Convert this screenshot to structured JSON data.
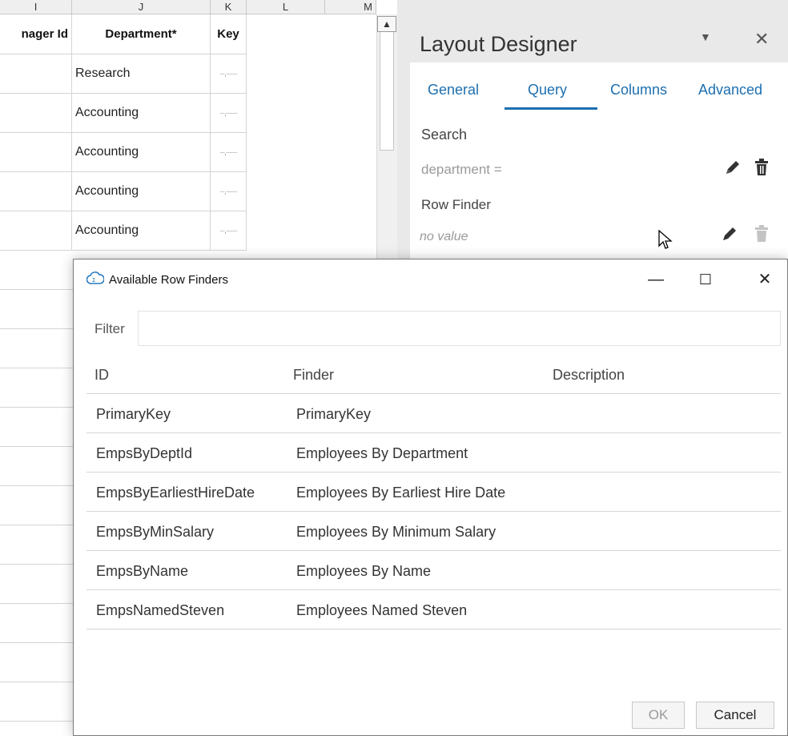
{
  "sheet": {
    "columns": [
      "I",
      "J",
      "K",
      "L",
      "M"
    ],
    "headers": {
      "manager_id": "nager Id",
      "department": "Department*",
      "key": "Key"
    },
    "rows": [
      {
        "dept": "Research",
        "key": "···,·······"
      },
      {
        "dept": "Accounting",
        "key": "···,·······"
      },
      {
        "dept": "Accounting",
        "key": "···,·······"
      },
      {
        "dept": "Accounting",
        "key": "···,·······"
      },
      {
        "dept": "Accounting",
        "key": "···,·······"
      }
    ]
  },
  "layout_designer": {
    "title": "Layout Designer",
    "tabs": [
      "General",
      "Query",
      "Columns",
      "Advanced"
    ],
    "active_tab": "Query",
    "search_label": "Search",
    "search_value": "department =",
    "row_finder_label": "Row Finder",
    "row_finder_value": "no value"
  },
  "dialog": {
    "title": "Available Row Finders",
    "filter_label": "Filter",
    "filter_value": "",
    "columns": [
      "ID",
      "Finder",
      "Description"
    ],
    "rows": [
      {
        "id": "PrimaryKey",
        "finder": "PrimaryKey",
        "description": ""
      },
      {
        "id": "EmpsByDeptId",
        "finder": "Employees By Department",
        "description": ""
      },
      {
        "id": "EmpsByEarliestHireDate",
        "finder": "Employees By Earliest Hire Date",
        "description": ""
      },
      {
        "id": "EmpsByMinSalary",
        "finder": "Employees By Minimum Salary",
        "description": ""
      },
      {
        "id": "EmpsByName",
        "finder": "Employees By Name",
        "description": ""
      },
      {
        "id": "EmpsNamedSteven",
        "finder": "Employees Named Steven",
        "description": ""
      }
    ],
    "ok_label": "OK",
    "cancel_label": "Cancel"
  },
  "colors": {
    "accent": "#1d6fb0",
    "disabled_text": "#9a9a9a"
  },
  "icons": [
    "pencil-icon",
    "trash-icon",
    "cloud-app-icon",
    "minimize-icon",
    "maximize-icon",
    "close-icon",
    "dropdown-arrow-icon",
    "mouse-cursor-icon"
  ]
}
